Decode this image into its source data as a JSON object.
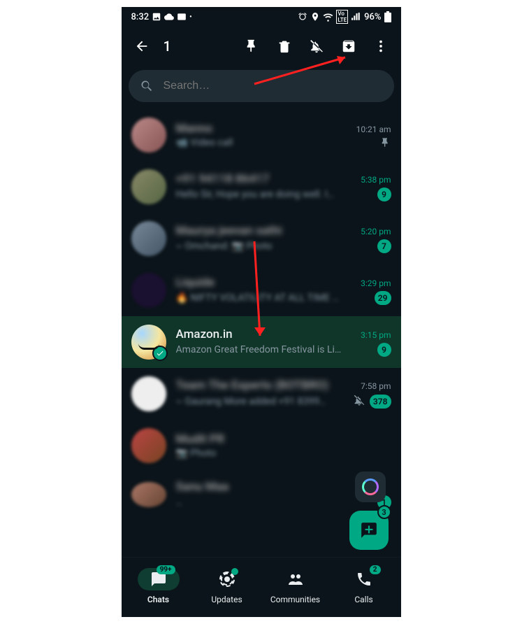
{
  "status": {
    "time": "8:32",
    "battery": "96%"
  },
  "topbar": {
    "selection_count": "1"
  },
  "search": {
    "placeholder": "Search…"
  },
  "chats": [
    {
      "name": "Manno",
      "msg": "📹 Video call",
      "time": "10:21 am",
      "time_green": false,
      "badge": "",
      "pinned": true,
      "muted": false,
      "blur": true
    },
    {
      "name": "+91 94118 86417",
      "msg": "Hello Sir,  Hope you are doing well.  I…",
      "time": "5:38 pm",
      "time_green": true,
      "badge": "9",
      "pinned": false,
      "muted": false,
      "blur": true
    },
    {
      "name": "Maurya jeevan sathi",
      "msg": "~ Omchand: 📷 Photo",
      "time": "5:20 pm",
      "time_green": true,
      "badge": "7",
      "pinned": false,
      "muted": false,
      "blur": true
    },
    {
      "name": "Liquide",
      "msg": "🔥 NIFTY VOLATILITY AT ALL TIME HI…",
      "time": "3:29 pm",
      "time_green": true,
      "badge": "29",
      "pinned": false,
      "muted": false,
      "blur": true
    },
    {
      "name": "Amazon.in",
      "msg": "Amazon Great Freedom Festival is Li…",
      "time": "3:15 pm",
      "time_green": true,
      "badge": "9",
      "pinned": false,
      "muted": false,
      "blur": false,
      "selected": true
    },
    {
      "name": "Team The Experts (BOTBRO)",
      "msg": "~ Gaurang More added +91 8399…",
      "time": "7:58 pm",
      "time_green": false,
      "badge": "378",
      "pinned": false,
      "muted": true,
      "blur": true
    },
    {
      "name": "Mudit PR",
      "msg": "📷 Photo",
      "time": "",
      "time_green": true,
      "badge": "",
      "pinned": false,
      "muted": false,
      "blur": true
    },
    {
      "name": "Sanu Maa",
      "msg": "…",
      "time": "",
      "time_green": true,
      "badge": "1",
      "pinned": false,
      "muted": false,
      "blur": true
    }
  ],
  "fab": {
    "badge": "3"
  },
  "nav": {
    "chats": {
      "label": "Chats",
      "badge": "99+"
    },
    "updates": {
      "label": "Updates"
    },
    "communities": {
      "label": "Communities"
    },
    "calls": {
      "label": "Calls",
      "badge": "2"
    }
  }
}
